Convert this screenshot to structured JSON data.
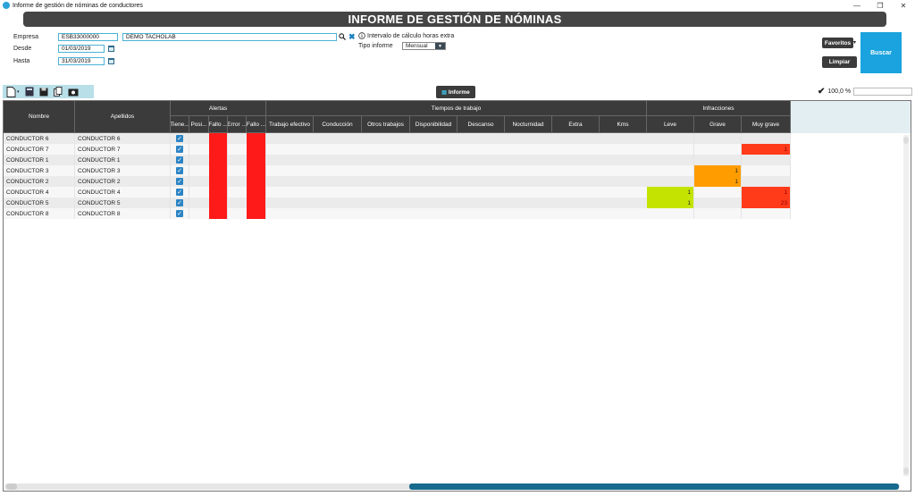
{
  "window": {
    "title": "Informe de gestión de nóminas de conductores",
    "min_glyph": "—",
    "restore_glyph": "❐",
    "close_glyph": "✕"
  },
  "header": {
    "title": "INFORME DE GESTIÓN DE NÓMINAS"
  },
  "filters": {
    "empresa_label": "Empresa",
    "empresa_code": "ESB33000000",
    "empresa_name": "DEMO TACHOLAB",
    "desde_label": "Desde",
    "desde_value": "01/03/2019",
    "hasta_label": "Hasta",
    "hasta_value": "31/03/2019",
    "intervalo_label": "Intervalo de cálculo horas extra",
    "tipo_label": "Tipo informe",
    "tipo_value": "Mensual"
  },
  "buttons": {
    "favoritos": "Favoritos",
    "limpiar": "Limpiar",
    "buscar": "Buscar",
    "informe": "Informe"
  },
  "progress": {
    "text": "100,0 %",
    "value": 100
  },
  "table": {
    "group_headers": {
      "alertas": "Alertas",
      "tiempos": "Tiempos de trabajo",
      "infracciones": "Infracciones"
    },
    "columns": {
      "nombre": "Nombre",
      "apellidos": "Apellidos",
      "tiene": "Tiene...",
      "posi": "Posi...",
      "fallo1": "Fallo ...",
      "error": "Error ...",
      "fallo2": "Fallo ...",
      "trabajo_efectivo": "Trabajo efectivo",
      "conduccion": "Conducción",
      "otros_trabajos": "Otros trabajos",
      "disponibilidad": "Disponibilidad",
      "descanso": "Descanso",
      "nocturnidad": "Nocturnidad",
      "extra": "Extra",
      "kms": "Kms",
      "leve": "Leve",
      "grave": "Grave",
      "muy_grave": "Muy grave"
    },
    "rows": [
      {
        "nombre": "CONDUCTOR 6",
        "apellidos": "CONDUCTOR 6",
        "leve": "",
        "grave": "",
        "muy_grave": ""
      },
      {
        "nombre": "CONDUCTOR 7",
        "apellidos": "CONDUCTOR 7",
        "leve": "",
        "grave": "",
        "muy_grave": "1"
      },
      {
        "nombre": "CONDUCTOR 1",
        "apellidos": "CONDUCTOR 1",
        "leve": "",
        "grave": "",
        "muy_grave": ""
      },
      {
        "nombre": "CONDUCTOR 3",
        "apellidos": "CONDUCTOR 3",
        "leve": "",
        "grave": "1",
        "muy_grave": ""
      },
      {
        "nombre": "CONDUCTOR 2",
        "apellidos": "CONDUCTOR 2",
        "leve": "",
        "grave": "1",
        "muy_grave": ""
      },
      {
        "nombre": "CONDUCTOR 4",
        "apellidos": "CONDUCTOR 4",
        "leve": "1",
        "grave": "",
        "muy_grave": "1"
      },
      {
        "nombre": "CONDUCTOR 5",
        "apellidos": "CONDUCTOR 5",
        "leve": "1",
        "grave": "",
        "muy_grave": "23"
      },
      {
        "nombre": "CONDUCTOR 8",
        "apellidos": "CONDUCTOR 8",
        "leve": "",
        "grave": "",
        "muy_grave": ""
      }
    ]
  },
  "colors": {
    "alert_red": "#ff1a1a",
    "infraccion_grave": "#ff9d00",
    "infraccion_leve": "#c5e300",
    "infraccion_muy_grave": "#ff3b1a",
    "accent": "#1aa3de",
    "header_dark": "#3b3b3b"
  }
}
